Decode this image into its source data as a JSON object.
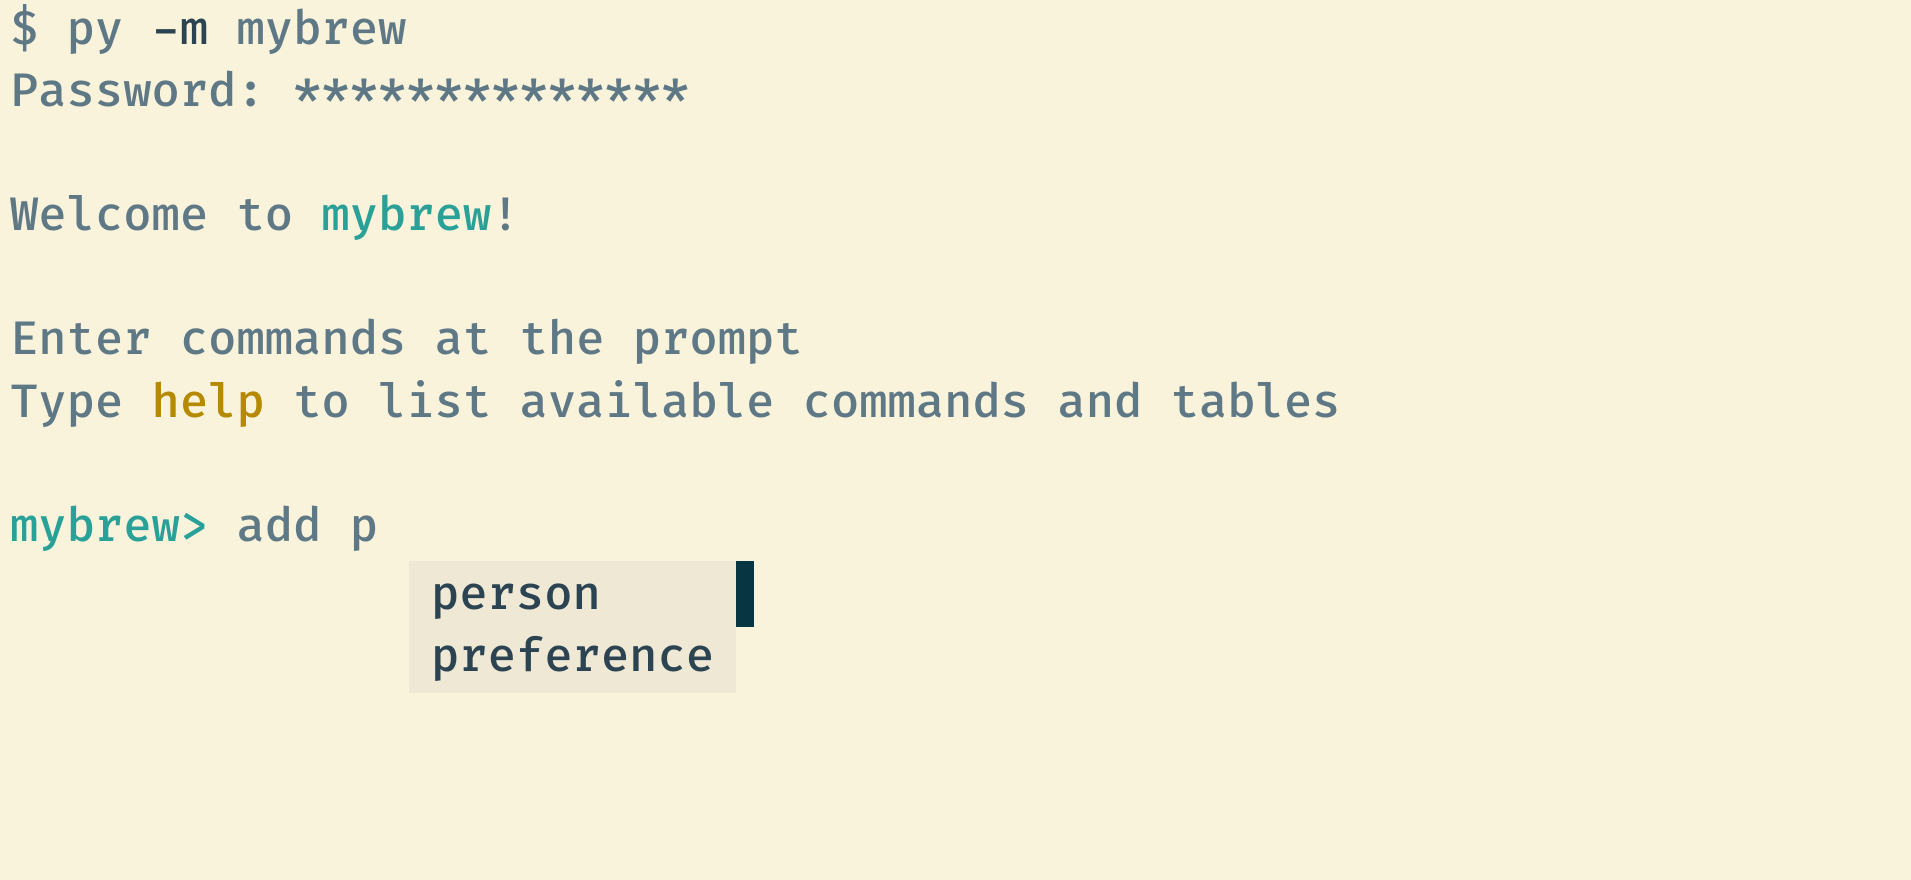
{
  "line1": {
    "prompt": "$ ",
    "cmd_part1": "py ",
    "flag": "-m",
    "cmd_part2": " mybrew"
  },
  "line2": {
    "label": "Password: ",
    "mask": "**************"
  },
  "blank": "",
  "line4": {
    "pre": "Welcome to ",
    "name": "mybrew",
    "post": "!"
  },
  "line6": "Enter commands at the prompt",
  "line7": {
    "pre": "Type ",
    "cmd": "help",
    "post": " to list available commands and tables"
  },
  "line9": {
    "prompt": "mybrew>",
    "input": " add p"
  },
  "completions": {
    "item1": "person",
    "item2": "preference"
  }
}
